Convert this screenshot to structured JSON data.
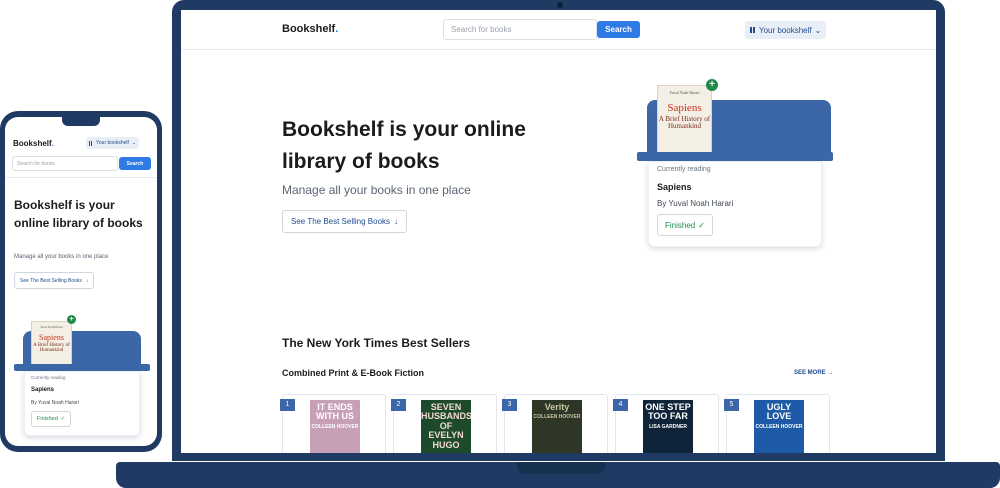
{
  "brand": {
    "name": "Bookshelf",
    "dot": "."
  },
  "header": {
    "search_placeholder": "Search for books",
    "search_button": "Search",
    "account_label": "Your bookshelf",
    "account_caret": "⌄"
  },
  "hero": {
    "title": "Bookshelf is your online library of books",
    "subtitle": "Manage all your books in one place",
    "cta_label": "See The Best Selling Books",
    "cta_arrow": "↓"
  },
  "reading": {
    "label": "Currently reading",
    "book_title": "Sapiens",
    "author": "By Yuval Noah Harari",
    "status": "Finished",
    "status_check": "✓",
    "plus": "+",
    "cover": {
      "author": "Yuval Noah Harari",
      "title": "Sapiens",
      "desc": "A Brief History of Humankind"
    }
  },
  "best_sellers": {
    "heading": "The New York Times Best Sellers",
    "list_name": "Combined Print & E-Book Fiction",
    "see_more": "SEE MORE →",
    "books": [
      {
        "rank": "1",
        "cover_text": "IT ENDS WITH US",
        "cover_author": "COLLEEN HOOVER",
        "cover_color": "#c7a0b8",
        "text_color": "#ffffff"
      },
      {
        "rank": "2",
        "cover_text": "SEVEN HUSBANDS OF EVELYN HUGO",
        "cover_author": "",
        "cover_color": "#1e4a2c",
        "text_color": "#f2d9d0"
      },
      {
        "rank": "3",
        "cover_text": "Verity",
        "cover_author": "COLLEEN HOOVER",
        "cover_color": "#2e3626",
        "text_color": "#c9c6a3"
      },
      {
        "rank": "4",
        "cover_text": "ONE STEP TOO FAR",
        "cover_author": "LISA GARDNER",
        "cover_color": "#0f2438",
        "text_color": "#ffffff"
      },
      {
        "rank": "5",
        "cover_text": "UGLY LOVE",
        "cover_author": "COLLEEN HOOVER",
        "cover_color": "#1f5aa8",
        "text_color": "#ffffff"
      }
    ]
  },
  "colors": {
    "frame": "#1f3a63",
    "accent": "#2f7be6",
    "shelf": "#3b66a8",
    "success": "#1f8a4a"
  }
}
